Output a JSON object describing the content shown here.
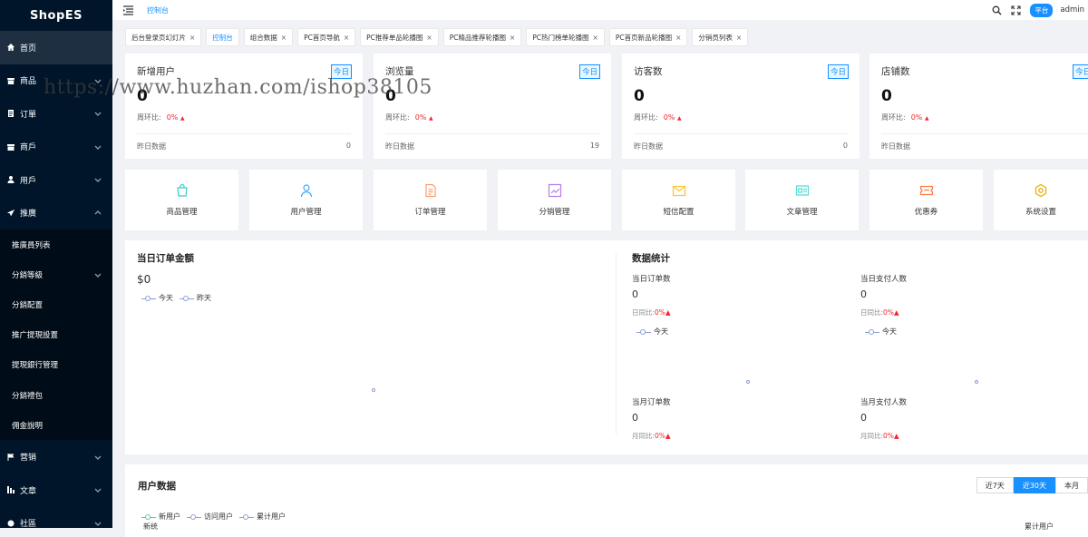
{
  "app": {
    "logo": "ShopES",
    "crumb": "控制台",
    "badge": "平台",
    "user": "admin"
  },
  "sidebar": {
    "items": [
      {
        "label": "首页",
        "icon": "home-icon",
        "active": true
      },
      {
        "label": "商品",
        "icon": "shop-icon"
      },
      {
        "label": "订單",
        "icon": "order-icon"
      },
      {
        "label": "商戶",
        "icon": "merchant-icon"
      },
      {
        "label": "用戶",
        "icon": "user-icon"
      },
      {
        "label": "推廣",
        "icon": "send-icon"
      }
    ],
    "sub": [
      "推廣員列表",
      "分銷等級",
      "分銷配置",
      "推广提現設置",
      "提現銀行管理",
      "分銷禮包",
      "佣金說明"
    ],
    "bottom": [
      {
        "label": "营销",
        "icon": "flag-icon"
      },
      {
        "label": "文章",
        "icon": "article-icon"
      },
      {
        "label": "社區",
        "icon": "community-icon"
      }
    ]
  },
  "tabs": [
    "后台登录页幻灯片",
    "控制台",
    "组合数据",
    "PC首页导航",
    "PC推荐单品轮播图",
    "PC精品推荐轮播图",
    "PC热门榜单轮播图",
    "PC首页新品轮播图",
    "分销员列表"
  ],
  "stats": [
    {
      "title": "新增用户",
      "tag": "今日",
      "value": "0",
      "cmp_label": "周环比:",
      "cmp_pct": "0%",
      "arrow": "▲",
      "yest_label": "昨日数据",
      "yest_val": "0"
    },
    {
      "title": "浏览量",
      "tag": "今日",
      "value": "0",
      "cmp_label": "周环比:",
      "cmp_pct": "0%",
      "arrow": "▲",
      "yest_label": "昨日数据",
      "yest_val": "19"
    },
    {
      "title": "访客数",
      "tag": "今日",
      "value": "0",
      "cmp_label": "周环比:",
      "cmp_pct": "0%",
      "arrow": "▲",
      "yest_label": "昨日数据",
      "yest_val": "0"
    },
    {
      "title": "店铺数",
      "tag": "今日",
      "value": "0",
      "cmp_label": "周环比:",
      "cmp_pct": "0%",
      "arrow": "▲",
      "yest_label": "昨日数据",
      "yest_val": ""
    }
  ],
  "quick": [
    {
      "label": "商品管理",
      "icon": "bag-icon",
      "color": "#36cfc9"
    },
    {
      "label": "用户管理",
      "icon": "user-icon",
      "color": "#40a9ff"
    },
    {
      "label": "订单管理",
      "icon": "file-icon",
      "color": "#ff9c6e"
    },
    {
      "label": "分销管理",
      "icon": "chart-icon",
      "color": "#b37feb"
    },
    {
      "label": "短信配置",
      "icon": "mail-icon",
      "color": "#ffc53d"
    },
    {
      "label": "文章管理",
      "icon": "card-icon",
      "color": "#5cdbd3"
    },
    {
      "label": "优惠券",
      "icon": "ticket-icon",
      "color": "#ff7a45"
    },
    {
      "label": "系统设置",
      "icon": "gear-icon",
      "color": "#fadb14"
    }
  ],
  "order": {
    "title": "当日订单金额",
    "amount": "$0",
    "legend": [
      "今天",
      "昨天"
    ]
  },
  "data_stats": {
    "title": "数据统计",
    "blocks": [
      {
        "label": "当日订单数",
        "value": "0",
        "cmp_label": "日同比:",
        "cmp_pct": "0%▲",
        "legend": "今天"
      },
      {
        "label": "当日支付人数",
        "value": "0",
        "cmp_label": "日同比:",
        "cmp_pct": "0%▲",
        "legend": "今天"
      },
      {
        "label": "当月订单数",
        "value": "0",
        "cmp_label": "月同比:",
        "cmp_pct": "0%▲"
      },
      {
        "label": "当月支付人数",
        "value": "0",
        "cmp_label": "月同比:",
        "cmp_pct": "0%▲"
      }
    ]
  },
  "user_data": {
    "title": "用户数据",
    "ranges": [
      "近7天",
      "近30天",
      "本月"
    ],
    "active_range": "近30天",
    "legend": [
      "新用户",
      "访问用户",
      "累计用户"
    ],
    "left_axis": "新统",
    "right_axis": "累计用户"
  },
  "watermark": "https://www.huzhan.com/ishop38105"
}
